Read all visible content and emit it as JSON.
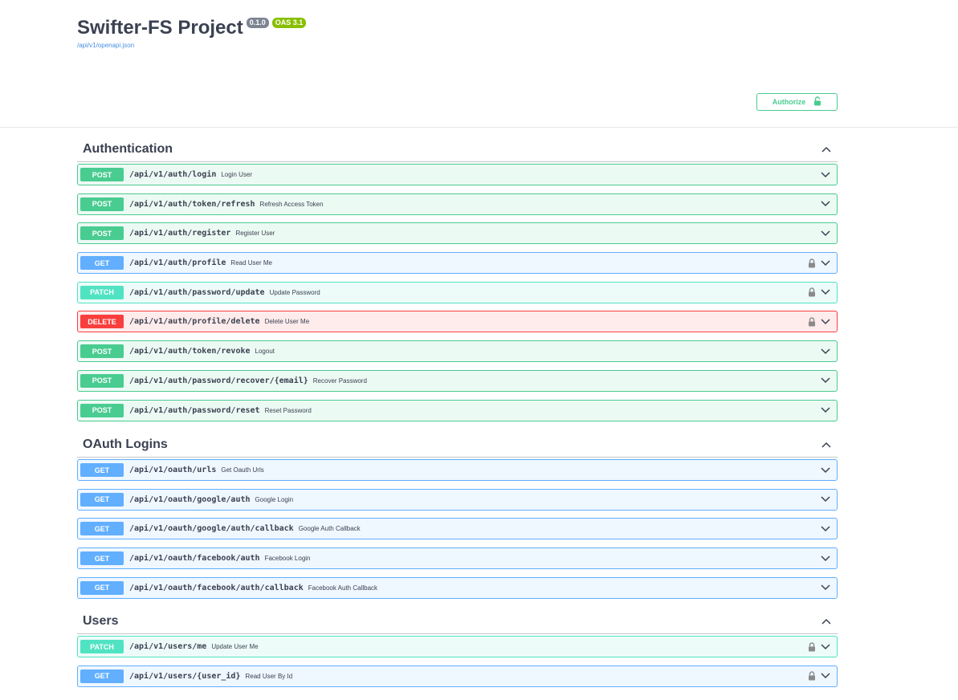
{
  "info": {
    "title": "Swifter-FS Project",
    "version": "0.1.0",
    "oas": "OAS 3.1",
    "spec_url": "/api/v1/openapi.json"
  },
  "authorize": {
    "label": "Authorize"
  },
  "colors": {
    "post": "#49cc90",
    "get": "#61affe",
    "patch": "#50e3c2",
    "delete": "#f93e3e",
    "text": "#3b4151"
  },
  "tags": [
    {
      "name": "Authentication",
      "ops": [
        {
          "method": "POST",
          "path": "/api/v1/auth/login",
          "summary": "Login User",
          "locked": false
        },
        {
          "method": "POST",
          "path": "/api/v1/auth/token/refresh",
          "summary": "Refresh Access Token",
          "locked": false
        },
        {
          "method": "POST",
          "path": "/api/v1/auth/register",
          "summary": "Register User",
          "locked": false
        },
        {
          "method": "GET",
          "path": "/api/v1/auth/profile",
          "summary": "Read User Me",
          "locked": true
        },
        {
          "method": "PATCH",
          "path": "/api/v1/auth/password/update",
          "summary": "Update Password",
          "locked": true
        },
        {
          "method": "DELETE",
          "path": "/api/v1/auth/profile/delete",
          "summary": "Delete User Me",
          "locked": true
        },
        {
          "method": "POST",
          "path": "/api/v1/auth/token/revoke",
          "summary": "Logout",
          "locked": false
        },
        {
          "method": "POST",
          "path": "/api/v1/auth/password/recover/{email}",
          "summary": "Recover Password",
          "locked": false
        },
        {
          "method": "POST",
          "path": "/api/v1/auth/password/reset",
          "summary": "Reset Password",
          "locked": false
        }
      ]
    },
    {
      "name": "OAuth Logins",
      "ops": [
        {
          "method": "GET",
          "path": "/api/v1/oauth/urls",
          "summary": "Get Oauth Urls",
          "locked": false
        },
        {
          "method": "GET",
          "path": "/api/v1/oauth/google/auth",
          "summary": "Google Login",
          "locked": false
        },
        {
          "method": "GET",
          "path": "/api/v1/oauth/google/auth/callback",
          "summary": "Google Auth Callback",
          "locked": false
        },
        {
          "method": "GET",
          "path": "/api/v1/oauth/facebook/auth",
          "summary": "Facebook Login",
          "locked": false
        },
        {
          "method": "GET",
          "path": "/api/v1/oauth/facebook/auth/callback",
          "summary": "Facebook Auth Callback",
          "locked": false
        }
      ]
    },
    {
      "name": "Users",
      "ops": [
        {
          "method": "PATCH",
          "path": "/api/v1/users/me",
          "summary": "Update User Me",
          "locked": true
        },
        {
          "method": "GET",
          "path": "/api/v1/users/{user_id}",
          "summary": "Read User By Id",
          "locked": true
        }
      ]
    }
  ]
}
